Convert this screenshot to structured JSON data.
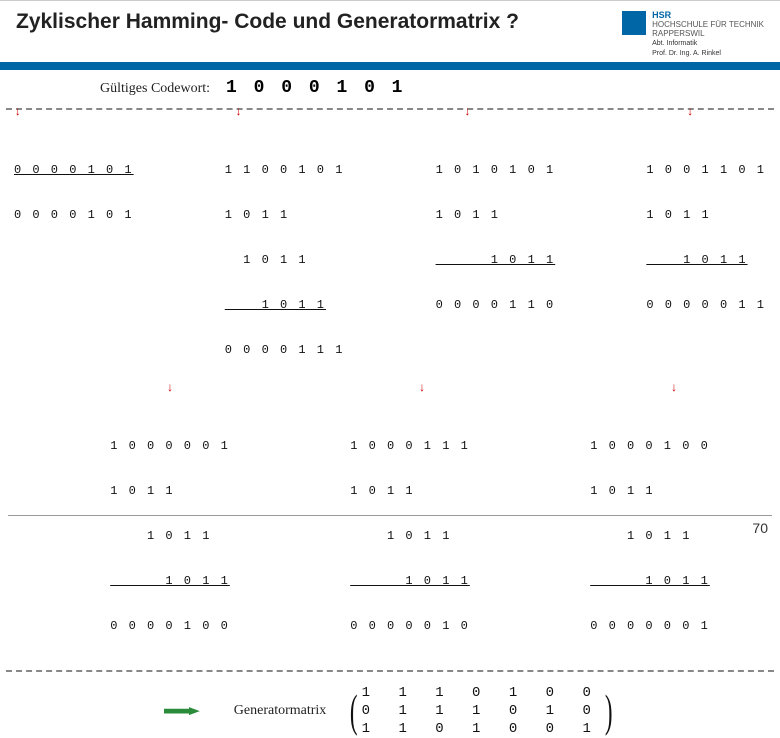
{
  "header": {
    "title": "Zyklischer Hamming- Code und Generatormatrix ?",
    "logo_abbr": "HSR",
    "logo_line1": "HOCHSCHULE FÜR TECHNIK",
    "logo_line2": "RAPPERSWIL",
    "dept": "Abt. Informatik",
    "prof": "Prof. Dr. Ing. A. Rinkel"
  },
  "codeword": {
    "label": "Gültiges Codewort:",
    "value": "1 0 0 0 1 0 1"
  },
  "calc_top": [
    [
      "0 0 0 0 1 0 1",
      "0 0 0 0 1 0 1"
    ],
    [
      "1 1 0 0 1 0 1",
      "1 0 1 1",
      "  1 0 1 1",
      "    1 0 1 1",
      "0 0 0 0 1 1 1"
    ],
    [
      "1 0 1 0 1 0 1",
      "1 0 1 1",
      "      1 0 1 1",
      "0 0 0 0 1 1 0"
    ],
    [
      "1 0 0 1 1 0 1",
      "1 0 1 1",
      "    1 0 1 1",
      "0 0 0 0 0 1 1"
    ]
  ],
  "calc_bottom": [
    [
      "1 0 0 0 0 0 1",
      "1 0 1 1",
      "    1 0 1 1",
      "      1 0 1 1",
      "0 0 0 0 1 0 0"
    ],
    [
      "1 0 0 0 1 1 1",
      "1 0 1 1",
      "    1 0 1 1",
      "      1 0 1 1",
      "0 0 0 0 0 1 0"
    ],
    [
      "1 0 0 0 1 0 0",
      "1 0 1 1",
      "    1 0 1 1",
      "      1 0 1 1",
      "0 0 0 0 0 0 1"
    ]
  ],
  "generator": {
    "label": "Generatormatrix",
    "matrix": [
      [
        "1",
        "1",
        "1",
        "0",
        "1",
        "0",
        "0"
      ],
      [
        "0",
        "1",
        "1",
        "1",
        "0",
        "1",
        "0"
      ],
      [
        "1",
        "1",
        "0",
        "1",
        "0",
        "0",
        "1"
      ]
    ]
  },
  "page": "70"
}
